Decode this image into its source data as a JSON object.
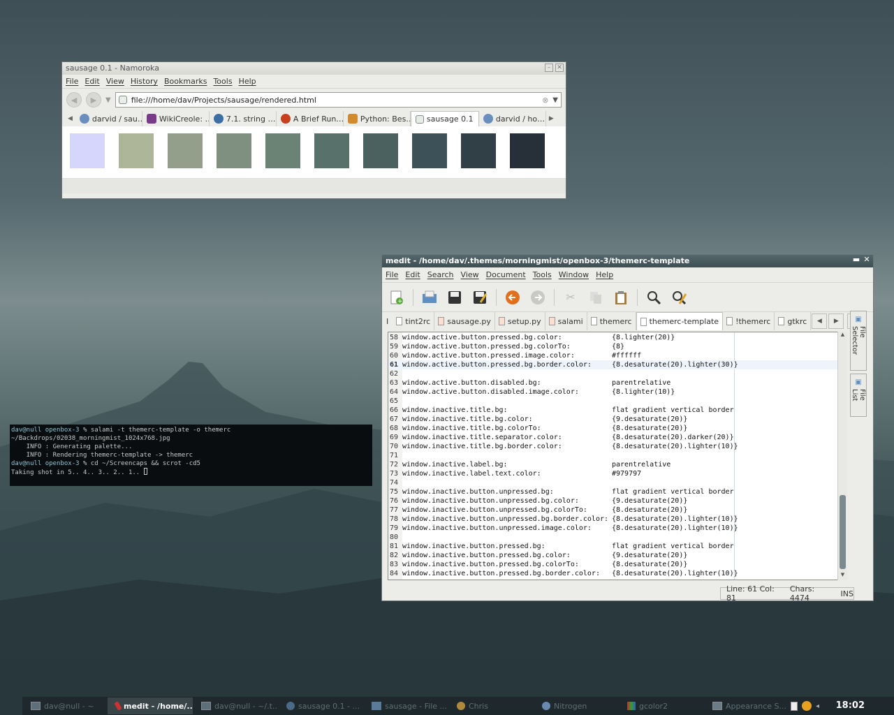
{
  "browser": {
    "title": "sausage 0.1 - Namoroka",
    "menu": [
      "File",
      "Edit",
      "View",
      "History",
      "Bookmarks",
      "Tools",
      "Help"
    ],
    "url": "file:///home/dav/Projects/sausage/rendered.html",
    "tabs": [
      {
        "label": "darvid / sau…",
        "icon": "globe-icon"
      },
      {
        "label": "WikiCreole: …",
        "icon": "wiki-icon"
      },
      {
        "label": "7.1. string …",
        "icon": "python-icon"
      },
      {
        "label": "A Brief Run…",
        "icon": "debian-icon"
      },
      {
        "label": "Python: Bes…",
        "icon": "stack-icon"
      },
      {
        "label": "sausage 0.1",
        "icon": "page-icon"
      },
      {
        "label": "darvid / ho…",
        "icon": "globe-icon"
      }
    ],
    "swatches": [
      "#d6d6fc",
      "#aeb69a",
      "#939f8a",
      "#7f9080",
      "#6b8375",
      "#58716a",
      "#4a615f",
      "#3c5158",
      "#313f47",
      "#272f39"
    ]
  },
  "terminal": {
    "lines": [
      {
        "prompt_user": "dav@null",
        "prompt_dir": "openbox-3",
        "text": " % salami -t themerc-template -o themerc ~/Backdrops/02038_morningmist_1024x768.jpg"
      },
      {
        "text": "    INFO : Generating palette..."
      },
      {
        "text": "    INFO : Rendering themerc-template -> themerc"
      },
      {
        "prompt_user": "dav@null",
        "prompt_dir": "openbox-3",
        "text": " % cd ~/Screencaps && scrot -cd5"
      },
      {
        "text": "Taking shot in 5.. 4.. 3.. 2.. 1.. "
      }
    ]
  },
  "medit": {
    "title": "medit - /home/dav/.themes/morningmist/openbox-3/themerc-template",
    "menu": [
      "File",
      "Edit",
      "Search",
      "View",
      "Document",
      "Tools",
      "Window",
      "Help"
    ],
    "doc_tabs": [
      "tint2rc",
      "sausage.py",
      "setup.py",
      "salami",
      "themerc",
      "themerc-template",
      "!themerc",
      "gtkrc"
    ],
    "active_tab": "themerc-template",
    "lines": [
      {
        "n": "58",
        "k": "window.active.button.pressed.bg.color:",
        "v": "{8.lighter(20)}"
      },
      {
        "n": "59",
        "k": "window.active.button.pressed.bg.colorTo:",
        "v": "{8}"
      },
      {
        "n": "60",
        "k": "window.active.button.pressed.image.color:",
        "v": "#ffffff"
      },
      {
        "n": "61",
        "k": "window.active.button.pressed.bg.border.color:",
        "v": "{8.desaturate(20).lighter(30)}"
      },
      {
        "n": "62",
        "k": "",
        "v": ""
      },
      {
        "n": "63",
        "k": "window.active.button.disabled.bg:",
        "v": "parentrelative"
      },
      {
        "n": "64",
        "k": "window.active.button.disabled.image.color:",
        "v": "{8.lighter(10)}"
      },
      {
        "n": "65",
        "k": "",
        "v": ""
      },
      {
        "n": "66",
        "k": "window.inactive.title.bg:",
        "v": "flat gradient vertical border"
      },
      {
        "n": "67",
        "k": "window.inactive.title.bg.color:",
        "v": "{9.desaturate(20)}"
      },
      {
        "n": "68",
        "k": "window.inactive.title.bg.colorTo:",
        "v": "{8.desaturate(20)}"
      },
      {
        "n": "69",
        "k": "window.inactive.title.separator.color:",
        "v": "{8.desaturate(20).darker(20)}"
      },
      {
        "n": "70",
        "k": "window.inactive.title.bg.border.color:",
        "v": "{8.desaturate(20).lighter(10)}"
      },
      {
        "n": "71",
        "k": "",
        "v": ""
      },
      {
        "n": "72",
        "k": "window.inactive.label.bg:",
        "v": "parentrelative"
      },
      {
        "n": "73",
        "k": "window.inactive.label.text.color:",
        "v": "#979797"
      },
      {
        "n": "74",
        "k": "",
        "v": ""
      },
      {
        "n": "75",
        "k": "window.inactive.button.unpressed.bg:",
        "v": "flat gradient vertical border"
      },
      {
        "n": "76",
        "k": "window.inactive.button.unpressed.bg.color:",
        "v": "{9.desaturate(20)}"
      },
      {
        "n": "77",
        "k": "window.inactive.button.unpressed.bg.colorTo:",
        "v": "{8.desaturate(20)}"
      },
      {
        "n": "78",
        "k": "window.inactive.button.unpressed.bg.border.color:",
        "v": "{8.desaturate(20).lighter(10)}"
      },
      {
        "n": "79",
        "k": "window.inactive.button.unpressed.image.color:",
        "v": "{8.desaturate(20).lighter(10)}"
      },
      {
        "n": "80",
        "k": "",
        "v": ""
      },
      {
        "n": "81",
        "k": "window.inactive.button.pressed.bg:",
        "v": "flat gradient vertical border"
      },
      {
        "n": "82",
        "k": "window.inactive.button.pressed.bg.color:",
        "v": "{9.desaturate(20)}"
      },
      {
        "n": "83",
        "k": "window.inactive.button.pressed.bg.colorTo:",
        "v": "{8.desaturate(20)}"
      },
      {
        "n": "84",
        "k": "window.inactive.button.pressed.bg.border.color:",
        "v": "{8.desaturate(20).lighter(10)}"
      }
    ],
    "side_tabs": [
      "File Selector",
      "File List"
    ],
    "status": {
      "pos": "Line: 61 Col: 81",
      "chars": "Chars: 4474",
      "mode": "INS"
    }
  },
  "taskbar": {
    "tasks": [
      {
        "label": "dav@null - ~",
        "active": false
      },
      {
        "label": "medit - /home/...",
        "active": true
      },
      {
        "label": "dav@null - ~/.t...",
        "active": false
      },
      {
        "label": "sausage 0.1 - ...",
        "active": false
      },
      {
        "label": "sausage - File ...",
        "active": false
      },
      {
        "label": "Chris",
        "active": false
      },
      {
        "label": "Nitrogen",
        "active": false
      },
      {
        "label": "gcolor2",
        "active": false
      },
      {
        "label": "Appearance S...",
        "active": false
      }
    ],
    "clock": "18:02"
  }
}
